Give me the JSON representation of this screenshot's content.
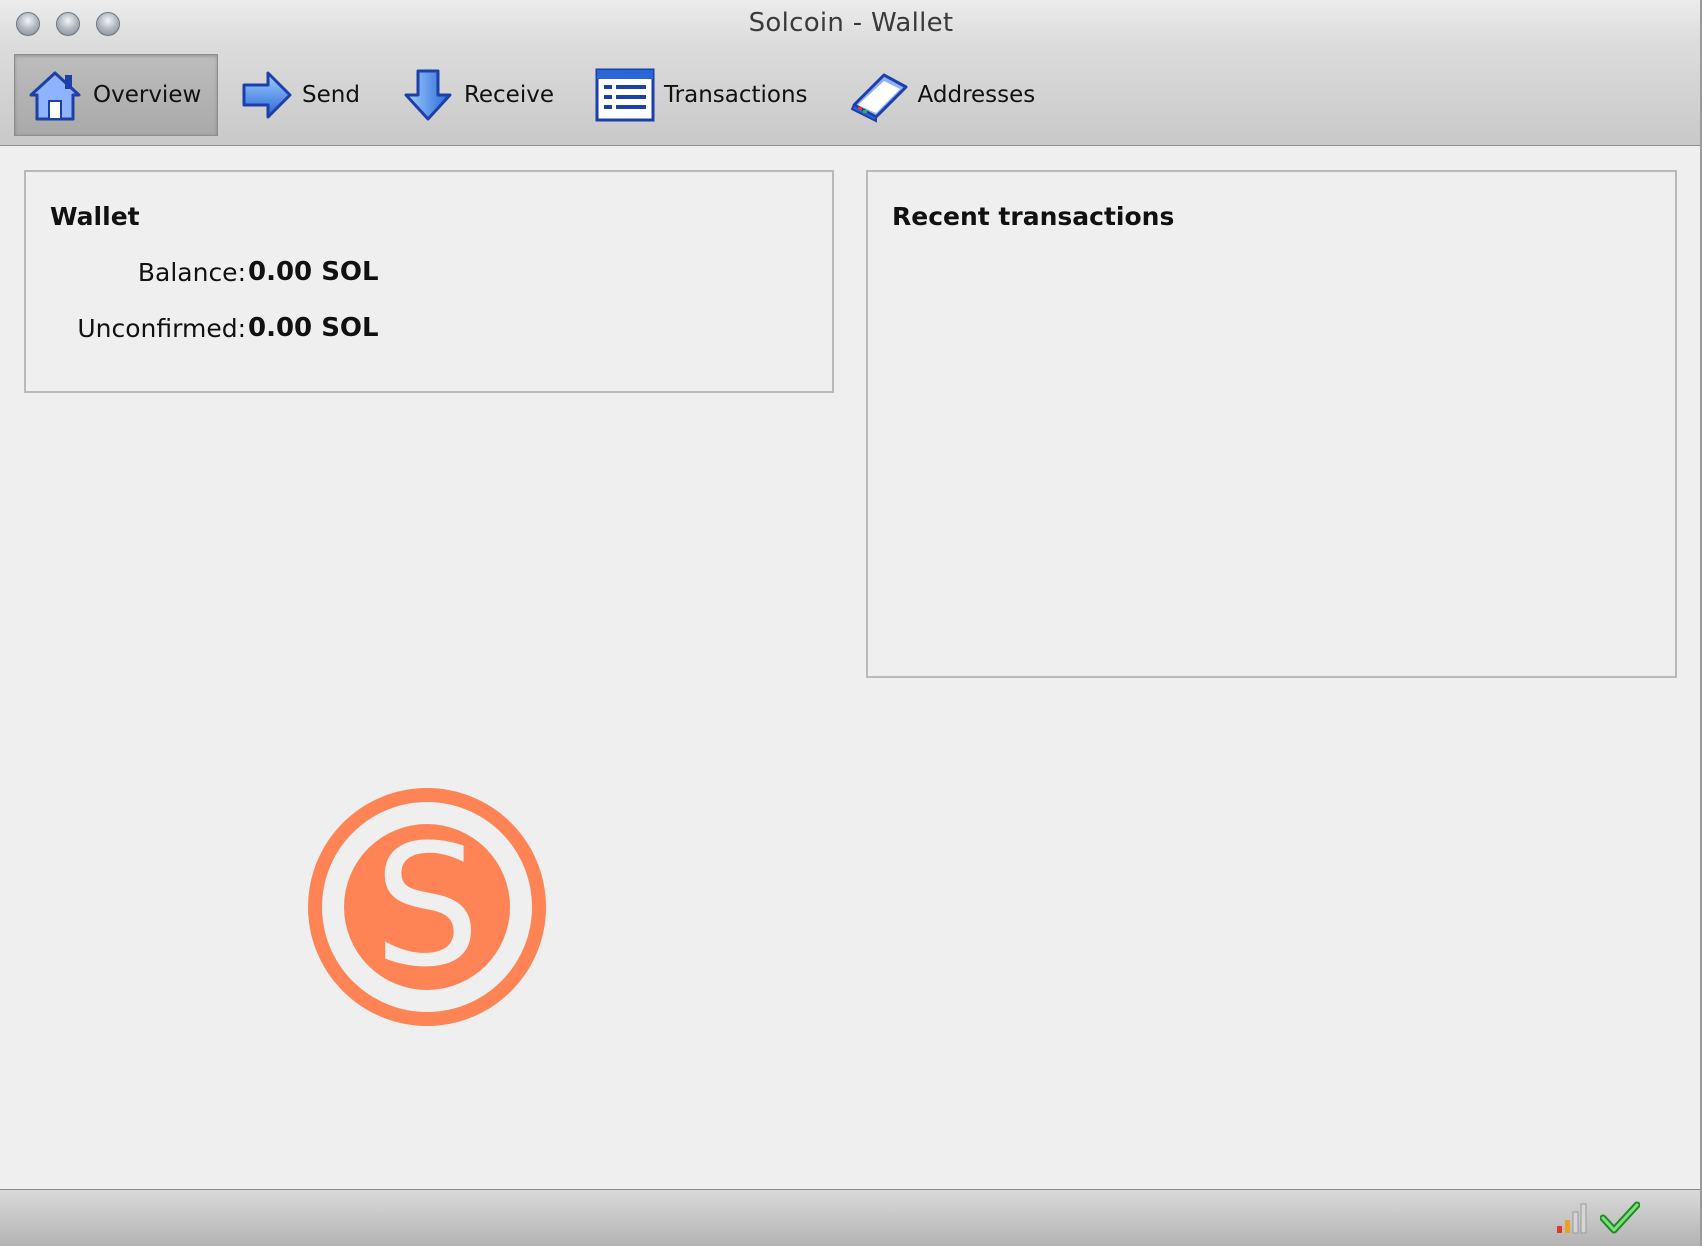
{
  "window": {
    "title": "Solcoin - Wallet"
  },
  "toolbar": {
    "items": [
      {
        "label": "Overview",
        "icon": "home-icon",
        "active": true
      },
      {
        "label": "Send",
        "icon": "send-arrow-icon",
        "active": false
      },
      {
        "label": "Receive",
        "icon": "receive-arrow-icon",
        "active": false
      },
      {
        "label": "Transactions",
        "icon": "transactions-list-icon",
        "active": false
      },
      {
        "label": "Addresses",
        "icon": "address-book-icon",
        "active": false
      }
    ]
  },
  "wallet": {
    "title": "Wallet",
    "balance_label": "Balance:",
    "balance_value": "0.00 SOL",
    "unconfirmed_label": "Unconfirmed:",
    "unconfirmed_value": "0.00 SOL"
  },
  "recent": {
    "title": "Recent transactions"
  },
  "logo": {
    "letter": "S",
    "color": "#ff8455"
  },
  "status": {
    "connection_icon": "signal-bars-icon",
    "sync_icon": "checkmark-icon"
  },
  "colors": {
    "accent": "#ff8455",
    "icon_blue": "#2a66d6"
  }
}
